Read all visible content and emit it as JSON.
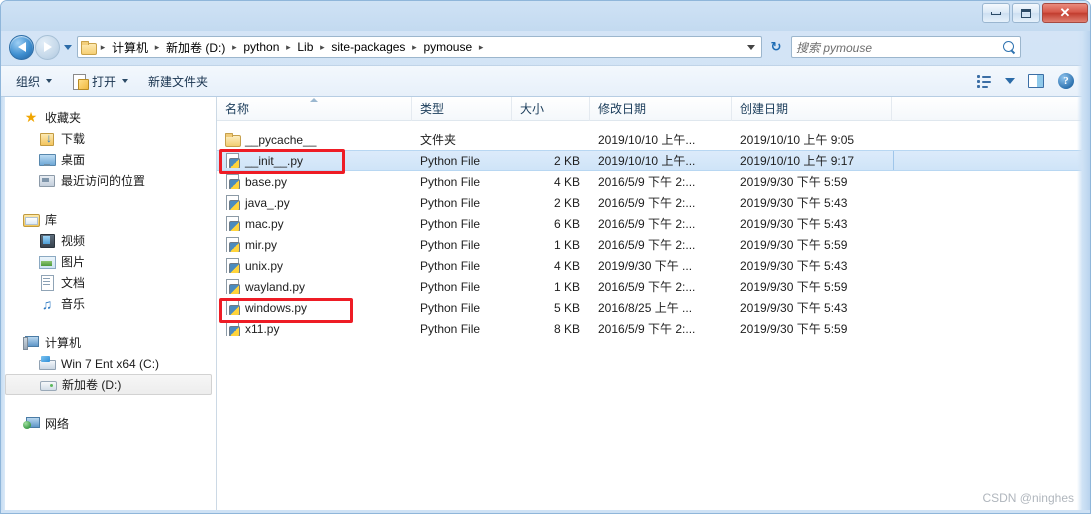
{
  "window": {
    "minimize_label": "–",
    "maximize_label": "❐",
    "close_label": "✕"
  },
  "navbar": {
    "back_tooltip": "后退",
    "forward_tooltip": "前进",
    "breadcrumbs": [
      "计算机",
      "新加卷 (D:)",
      "python",
      "Lib",
      "site-packages",
      "pymouse"
    ],
    "separator": "▸",
    "refresh_label": "↻",
    "search_placeholder": "搜索 pymouse"
  },
  "toolbar": {
    "organize_label": "组织",
    "open_label": "打开",
    "new_folder_label": "新建文件夹",
    "help_label": "?"
  },
  "navpane": {
    "groups": [
      {
        "header": "收藏夹",
        "header_icon": "star-icon",
        "items": [
          {
            "label": "下载",
            "icon": "download-icon"
          },
          {
            "label": "桌面",
            "icon": "desktop-icon"
          },
          {
            "label": "最近访问的位置",
            "icon": "recent-places-icon"
          }
        ]
      },
      {
        "header": "库",
        "header_icon": "library-icon",
        "items": [
          {
            "label": "视频",
            "icon": "video-icon"
          },
          {
            "label": "图片",
            "icon": "pictures-icon"
          },
          {
            "label": "文档",
            "icon": "documents-icon"
          },
          {
            "label": "音乐",
            "icon": "music-icon"
          }
        ]
      },
      {
        "header": "计算机",
        "header_icon": "computer-icon",
        "items": [
          {
            "label": "Win 7 Ent x64 (C:)",
            "icon": "drive-c-icon",
            "selected": false
          },
          {
            "label": "新加卷 (D:)",
            "icon": "drive-d-icon",
            "selected": true
          }
        ]
      },
      {
        "header": "网络",
        "header_icon": "network-icon",
        "items": []
      }
    ]
  },
  "filelist": {
    "columns": [
      {
        "key": "name",
        "label": "名称",
        "sorted": "asc"
      },
      {
        "key": "type",
        "label": "类型",
        "sorted": ""
      },
      {
        "key": "size",
        "label": "大小",
        "sorted": ""
      },
      {
        "key": "modified",
        "label": "修改日期",
        "sorted": ""
      },
      {
        "key": "created",
        "label": "创建日期",
        "sorted": ""
      }
    ],
    "rows": [
      {
        "name": "__pycache__",
        "icon": "folder-icon",
        "type": "文件夹",
        "size": "",
        "modified": "2019/10/10 上午...",
        "created": "2019/10/10 上午 9:05",
        "selected": false,
        "annotated": false
      },
      {
        "name": "__init__.py",
        "icon": "python-file-icon",
        "type": "Python File",
        "size": "2 KB",
        "modified": "2019/10/10 上午...",
        "created": "2019/10/10 上午 9:17",
        "selected": true,
        "annotated": true
      },
      {
        "name": "base.py",
        "icon": "python-file-icon",
        "type": "Python File",
        "size": "4 KB",
        "modified": "2016/5/9 下午 2:...",
        "created": "2019/9/30 下午 5:59",
        "selected": false,
        "annotated": false
      },
      {
        "name": "java_.py",
        "icon": "python-file-icon",
        "type": "Python File",
        "size": "2 KB",
        "modified": "2016/5/9 下午 2:...",
        "created": "2019/9/30 下午 5:43",
        "selected": false,
        "annotated": false
      },
      {
        "name": "mac.py",
        "icon": "python-file-icon",
        "type": "Python File",
        "size": "6 KB",
        "modified": "2016/5/9 下午 2:...",
        "created": "2019/9/30 下午 5:43",
        "selected": false,
        "annotated": false
      },
      {
        "name": "mir.py",
        "icon": "python-file-icon",
        "type": "Python File",
        "size": "1 KB",
        "modified": "2016/5/9 下午 2:...",
        "created": "2019/9/30 下午 5:59",
        "selected": false,
        "annotated": false
      },
      {
        "name": "unix.py",
        "icon": "python-file-icon",
        "type": "Python File",
        "size": "4 KB",
        "modified": "2019/9/30 下午 ...",
        "created": "2019/9/30 下午 5:43",
        "selected": false,
        "annotated": false
      },
      {
        "name": "wayland.py",
        "icon": "python-file-icon",
        "type": "Python File",
        "size": "1 KB",
        "modified": "2016/5/9 下午 2:...",
        "created": "2019/9/30 下午 5:59",
        "selected": false,
        "annotated": false
      },
      {
        "name": "windows.py",
        "icon": "python-file-icon",
        "type": "Python File",
        "size": "5 KB",
        "modified": "2016/8/25 上午 ...",
        "created": "2019/9/30 下午 5:43",
        "selected": false,
        "annotated": true
      },
      {
        "name": "x11.py",
        "icon": "python-file-icon",
        "type": "Python File",
        "size": "8 KB",
        "modified": "2016/5/9 下午 2:...",
        "created": "2019/9/30 下午 5:59",
        "selected": false,
        "annotated": false
      }
    ]
  },
  "watermark": {
    "text": "CSDN @ninghes"
  },
  "colors": {
    "annotation_red": "#ee1c25",
    "selection_blue": "#cfe4f8",
    "aero_glass": "#cfe2f5",
    "close_button_red": "#d6584a"
  }
}
